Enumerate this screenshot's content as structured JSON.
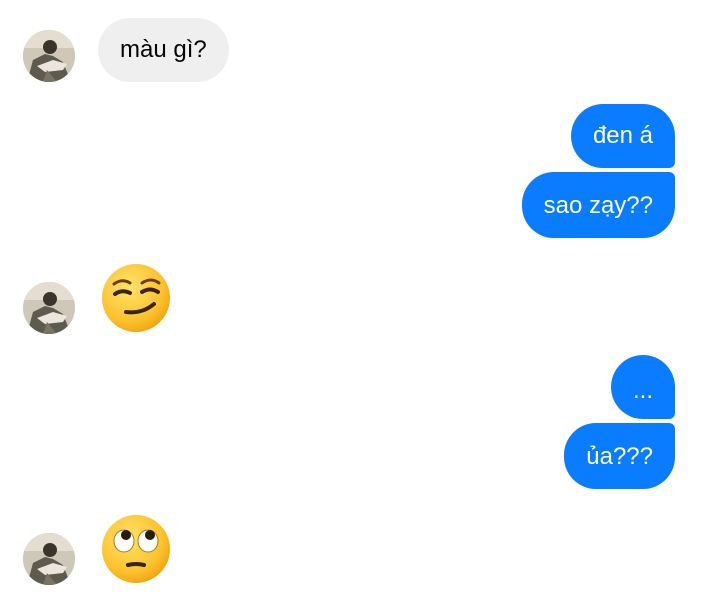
{
  "messages": [
    {
      "side": "incoming",
      "kind": "text",
      "text": "màu gì?"
    },
    {
      "side": "outgoing",
      "kind": "text",
      "text": "đen á"
    },
    {
      "side": "outgoing",
      "kind": "text",
      "text": "sao zạy??"
    },
    {
      "side": "incoming",
      "kind": "emoji",
      "emoji": "smirking-face"
    },
    {
      "side": "outgoing",
      "kind": "text",
      "text": "..."
    },
    {
      "side": "outgoing",
      "kind": "text",
      "text": "ủa???"
    },
    {
      "side": "incoming",
      "kind": "emoji",
      "emoji": "face-with-rolling-eyes"
    }
  ],
  "colors": {
    "outgoing_bubble": "#0a7cff",
    "incoming_bubble": "#efefef",
    "outgoing_text": "#ffffff",
    "incoming_text": "#050505"
  }
}
